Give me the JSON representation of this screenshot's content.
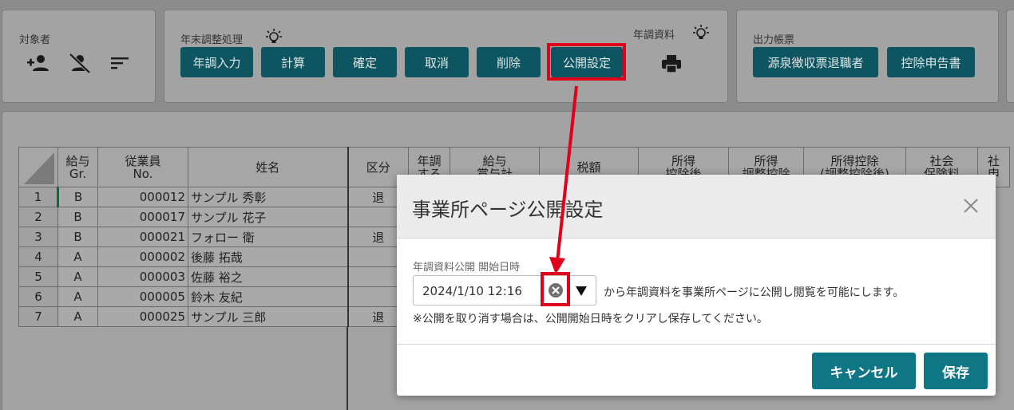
{
  "toolbar": {
    "target": {
      "label": "対象者",
      "icons": [
        "person-add-icon",
        "person-off-icon",
        "sort-icon"
      ]
    },
    "year_end": {
      "label": "年末調整処理",
      "buttons": [
        "年調入力",
        "計算",
        "確定",
        "取消",
        "削除",
        "公開設定"
      ]
    },
    "materials": {
      "label": "年調資料",
      "icon": "printer-icon"
    },
    "forms": {
      "label": "出力帳票",
      "buttons": [
        "源泉徴収票退職者",
        "控除申告書"
      ]
    }
  },
  "table": {
    "headers": [
      "給与\nGr.",
      "従業員\nNo.",
      "姓名",
      "区分",
      "年調\nする",
      "給与\n賞与計",
      "税額",
      "所得\n控除後",
      "所得\n調整控除",
      "所得控除\n(調整控除後)",
      "社会\n保険料",
      "社\n申"
    ],
    "rows": [
      {
        "n": "1",
        "gr": "B",
        "no": "000012",
        "name": "サンプル 秀彰",
        "kubun": "退"
      },
      {
        "n": "2",
        "gr": "B",
        "no": "000017",
        "name": "サンプル 花子",
        "kubun": ""
      },
      {
        "n": "3",
        "gr": "B",
        "no": "000021",
        "name": "フォロー 衛",
        "kubun": "退"
      },
      {
        "n": "4",
        "gr": "A",
        "no": "000002",
        "name": "後藤 拓哉",
        "kubun": ""
      },
      {
        "n": "5",
        "gr": "A",
        "no": "000003",
        "name": "佐藤 裕之",
        "kubun": ""
      },
      {
        "n": "6",
        "gr": "A",
        "no": "000005",
        "name": "鈴木 友紀",
        "kubun": ""
      },
      {
        "n": "7",
        "gr": "A",
        "no": "000025",
        "name": "サンプル 三郎",
        "kubun": "退"
      }
    ]
  },
  "modal": {
    "title": "事業所ページ公開設定",
    "field_label": "年調資料公開 開始日時",
    "date_value": "2024/1/10 12:16",
    "description": "から年調資料を事業所ページに公開し閲覧を可能にします。",
    "note": "※公開を取り消す場合は、公開開始日時をクリアし保存してください。",
    "cancel_label": "キャンセル",
    "save_label": "保存"
  },
  "colors": {
    "teal": "#0d5560",
    "modal_btn": "#0f7686",
    "highlight": "#e0001b"
  }
}
